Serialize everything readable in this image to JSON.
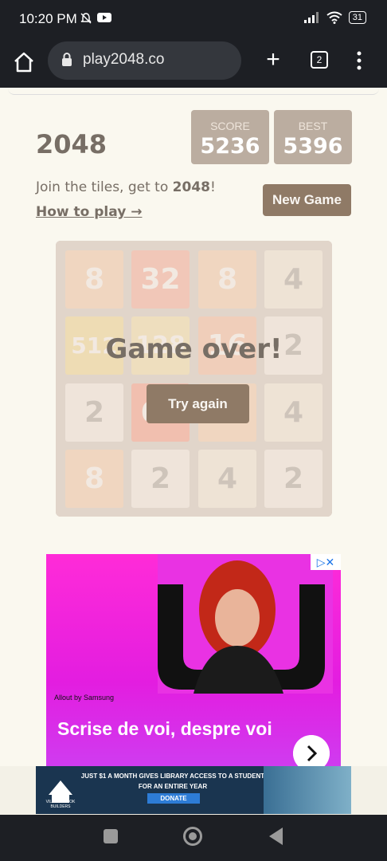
{
  "status": {
    "time": "10:20 PM",
    "battery": "31"
  },
  "browser": {
    "url": "play2048.co",
    "new_tab": "+",
    "tab_count": "2"
  },
  "game": {
    "title": "2048",
    "score_label": "SCORE",
    "score": "5236",
    "best_label": "BEST",
    "best": "5396",
    "intro_text": "Join the tiles, get to ",
    "intro_goal": "2048",
    "intro_end": "!",
    "how_to_play": "How to play →",
    "new_game": "New Game",
    "game_over": "Game over!",
    "try_again": "Try again",
    "tiles": [
      [
        "8",
        "32",
        "8",
        "4"
      ],
      [
        "512",
        "128",
        "16",
        "2"
      ],
      [
        "2",
        "64",
        "8",
        "4"
      ],
      [
        "8",
        "2",
        "4",
        "2"
      ]
    ]
  },
  "ad": {
    "brand": "Allout by Samsung",
    "headline": "Scrise de voi, despre voi"
  },
  "banner": {
    "logo_text": "VILLAGE BOOK BUILDERS",
    "message": "JUST $1 A MONTH GIVES LIBRARY ACCESS TO A STUDENT FOR AN ENTIRE YEAR",
    "donate": "DONATE"
  }
}
